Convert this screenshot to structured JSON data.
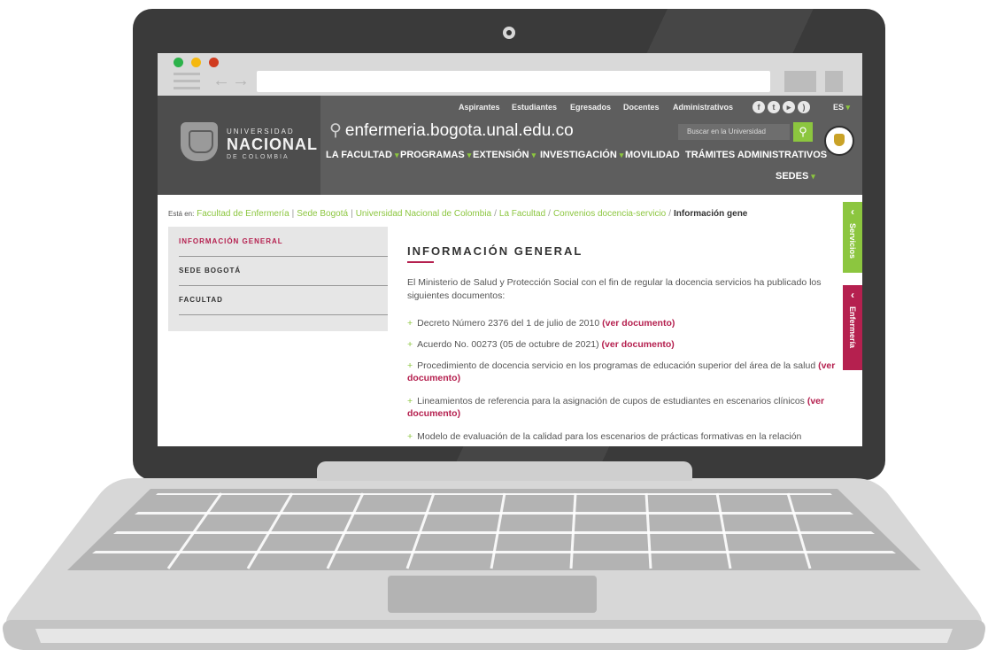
{
  "browser": {
    "address_value": "",
    "back_icon": "arrow-left-icon",
    "forward_icon": "arrow-right-icon",
    "menu_icon": "hamburger-icon",
    "traffic_lights": [
      "#2cb24a",
      "#f5b80f",
      "#d03b1f"
    ]
  },
  "header": {
    "logo_line1": "UNIVERSIDAD",
    "logo_line2": "NACIONAL",
    "logo_line3": "DE COLOMBIA",
    "top_links": [
      "Aspirantes",
      "Estudiantes",
      "Egresados",
      "Docentes",
      "Administrativos"
    ],
    "social_icons": [
      "facebook-icon",
      "twitter-icon",
      "youtube-icon",
      "rss-icon"
    ],
    "lang": "ES",
    "site_url": "enfermeria.bogota.unal.edu.co",
    "search_placeholder": "Buscar en la Universidad",
    "nav": [
      "LA FACULTAD",
      "PROGRAMAS",
      "EXTENSIÓN",
      "INVESTIGACIÓN",
      "MOVILIDAD",
      "TRÁMITES ADMINISTRATIVOS",
      "SEDES"
    ]
  },
  "breadcrumb": {
    "lead": "Está en:",
    "items": [
      "Facultad de Enfermería",
      "Sede Bogotá",
      "Universidad Nacional de Colombia",
      "La Facultad",
      "Convenios docencia-servicio"
    ],
    "current": "Información gene"
  },
  "sidebar": {
    "items": [
      "INFORMACIÓN GENERAL",
      "SEDE BOGOTÁ",
      "FACULTAD"
    ]
  },
  "content": {
    "title": "INFORMACIÓN GENERAL",
    "intro": "El Ministerio de Salud y Protección Social con el fin de regular la docencia servicios ha publicado los siguientes documentos:",
    "link_label": "(ver documento)",
    "items": [
      "Decreto Número 2376 del 1 de julio de 2010",
      "Acuerdo No. 00273 (05 de octubre de 2021)",
      "Procedimiento de docencia servicio en los programas de educación superior del área de la salud",
      "Lineamientos de referencia para la asignación de cupos de estudiantes en escenarios clínicos",
      "Modelo de evaluación de la calidad para los escenarios de prácticas formativas en la relación"
    ]
  },
  "side_tabs": {
    "servicios": "Servicios",
    "enfermeria": "Enfermería"
  },
  "colors": {
    "accent_green": "#8cc63f",
    "accent_red": "#b5204f",
    "header_gray": "#5e5e5e"
  }
}
